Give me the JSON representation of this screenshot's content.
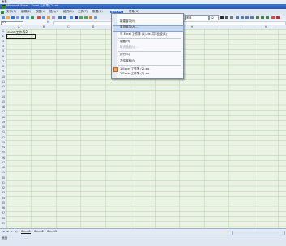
{
  "topstrip": {
    "text": "画板"
  },
  "window": {
    "title": "Microsoft Excel - Excel 工作簿 (2).xls"
  },
  "menubar": {
    "items": [
      "文件(F)",
      "编辑(E)",
      "视图(V)",
      "插入(I)",
      "格式(O)",
      "工具(T)",
      "数据(D)",
      "窗口(W)",
      "帮助(H)"
    ],
    "active_index": 7
  },
  "toolbar": {
    "font_name": "宋体",
    "font_size": "12"
  },
  "formula_bar": {
    "name_box": "A2",
    "fx": "fx"
  },
  "columns": [
    "A",
    "B",
    "C",
    "D",
    "E",
    "F",
    "G",
    "H",
    "I",
    "J",
    "K",
    "L"
  ],
  "rows": [
    "1",
    "2",
    "3",
    "4",
    "5",
    "6",
    "7",
    "8",
    "9",
    "10",
    "11",
    "12",
    "13",
    "14",
    "15",
    "16",
    "17",
    "18",
    "19",
    "20",
    "21",
    "22",
    "23",
    "24",
    "25",
    "26",
    "27",
    "28",
    "29",
    "30",
    "31",
    "32",
    "33",
    "34",
    "35",
    "36",
    "37",
    "38",
    "39"
  ],
  "cells": {
    "A1": "excel工作表2"
  },
  "window_menu": {
    "items": [
      {
        "label": "新建窗口(N)",
        "disabled": false
      },
      {
        "label": "重排窗口(A)...",
        "disabled": false,
        "highlighted": true
      },
      {
        "label": "与 Excel 工作簿 (1).xls 并排比较(B)",
        "disabled": false
      },
      {
        "label": "隐藏(H)",
        "disabled": false
      },
      {
        "label": "取消隐藏(U)...",
        "disabled": true
      },
      {
        "label": "拆分(S)",
        "disabled": false
      },
      {
        "label": "冻结窗格(F)",
        "disabled": false
      },
      {
        "label": "1 Excel 工作簿 (2).xls",
        "disabled": false,
        "checked": true
      },
      {
        "label": "2 Excel 工作簿 (1).xls",
        "disabled": false
      }
    ]
  },
  "sheet_tabs": {
    "nav": [
      "|◄",
      "◄",
      "►",
      "►|"
    ],
    "tabs": [
      "Sheet1",
      "Sheet2",
      "Sheet3"
    ],
    "active_index": 0
  },
  "status": {
    "text": "就绪"
  },
  "colors": {
    "grid_bg": "#eaf3e4",
    "title_bg": "#2459b8",
    "menu_highlight": "#c8d9f3",
    "accent": "#3167c5"
  }
}
